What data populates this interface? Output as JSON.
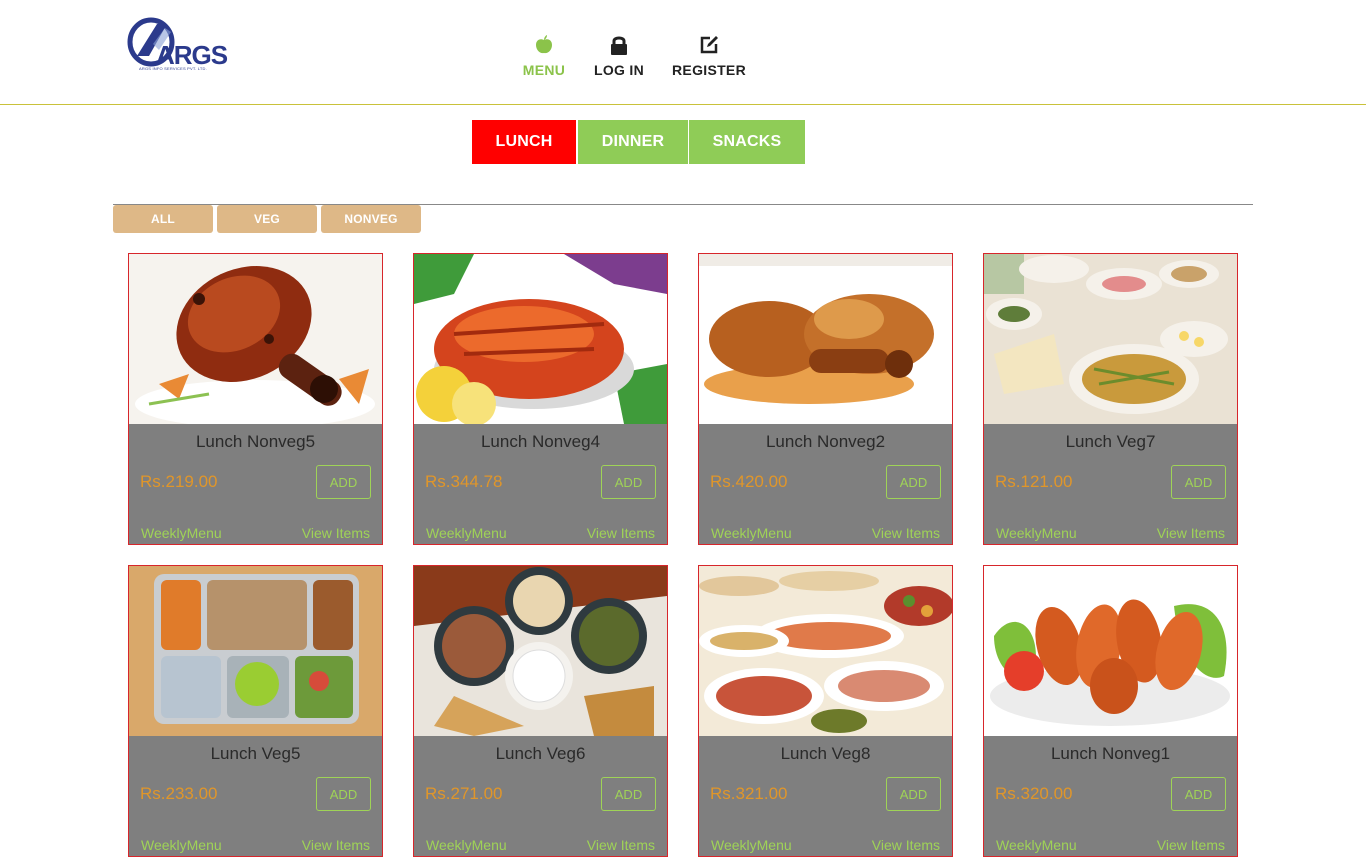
{
  "header": {
    "logo_text": "ARGS",
    "logo_subtext": "ARGS INFO SERVICES PVT. LTD.",
    "nav": [
      {
        "label": "MENU",
        "icon": "apple-icon",
        "active": true
      },
      {
        "label": "LOG IN",
        "icon": "lock-icon",
        "active": false
      },
      {
        "label": "REGISTER",
        "icon": "edit-icon",
        "active": false
      }
    ]
  },
  "meal_tabs": [
    {
      "label": "LUNCH",
      "active": true,
      "color": "#ff0000"
    },
    {
      "label": "DINNER",
      "active": false,
      "color": "#8fcc57"
    },
    {
      "label": "SNACKS",
      "active": false,
      "color": "#8fcc57"
    }
  ],
  "filters": [
    {
      "label": "ALL"
    },
    {
      "label": "VEG"
    },
    {
      "label": "NONVEG"
    }
  ],
  "items": [
    {
      "name": "Lunch Nonveg5",
      "price": "Rs.219.00",
      "add_label": "ADD",
      "weekly_label": "WeeklyMenu",
      "view_label": "View Items",
      "image": "tandoori-leg"
    },
    {
      "name": "Lunch Nonveg4",
      "price": "Rs.344.78",
      "add_label": "ADD",
      "weekly_label": "WeeklyMenu",
      "view_label": "View Items",
      "image": "tandoori-plate"
    },
    {
      "name": "Lunch Nonveg2",
      "price": "Rs.420.00",
      "add_label": "ADD",
      "weekly_label": "WeeklyMenu",
      "view_label": "View Items",
      "image": "roast-chicken"
    },
    {
      "name": "Lunch Veg7",
      "price": "Rs.121.00",
      "add_label": "ADD",
      "weekly_label": "WeeklyMenu",
      "view_label": "View Items",
      "image": "buffet"
    },
    {
      "name": "Lunch Veg5",
      "price": "Rs.233.00",
      "add_label": "ADD",
      "weekly_label": "WeeklyMenu",
      "view_label": "View Items",
      "image": "lunch-tray"
    },
    {
      "name": "Lunch Veg6",
      "price": "Rs.271.00",
      "add_label": "ADD",
      "weekly_label": "WeeklyMenu",
      "view_label": "View Items",
      "image": "thali"
    },
    {
      "name": "Lunch Veg8",
      "price": "Rs.321.00",
      "add_label": "ADD",
      "weekly_label": "WeeklyMenu",
      "view_label": "View Items",
      "image": "catering-spread"
    },
    {
      "name": "Lunch Nonveg1",
      "price": "Rs.320.00",
      "add_label": "ADD",
      "weekly_label": "WeeklyMenu",
      "view_label": "View Items",
      "image": "chicken-drumsticks"
    }
  ],
  "colors": {
    "accent_green": "#8fcc57",
    "active_red": "#ff0000",
    "filter_tan": "#deb887",
    "card_gray": "#7f7f7f",
    "price_orange": "#e0962a"
  }
}
